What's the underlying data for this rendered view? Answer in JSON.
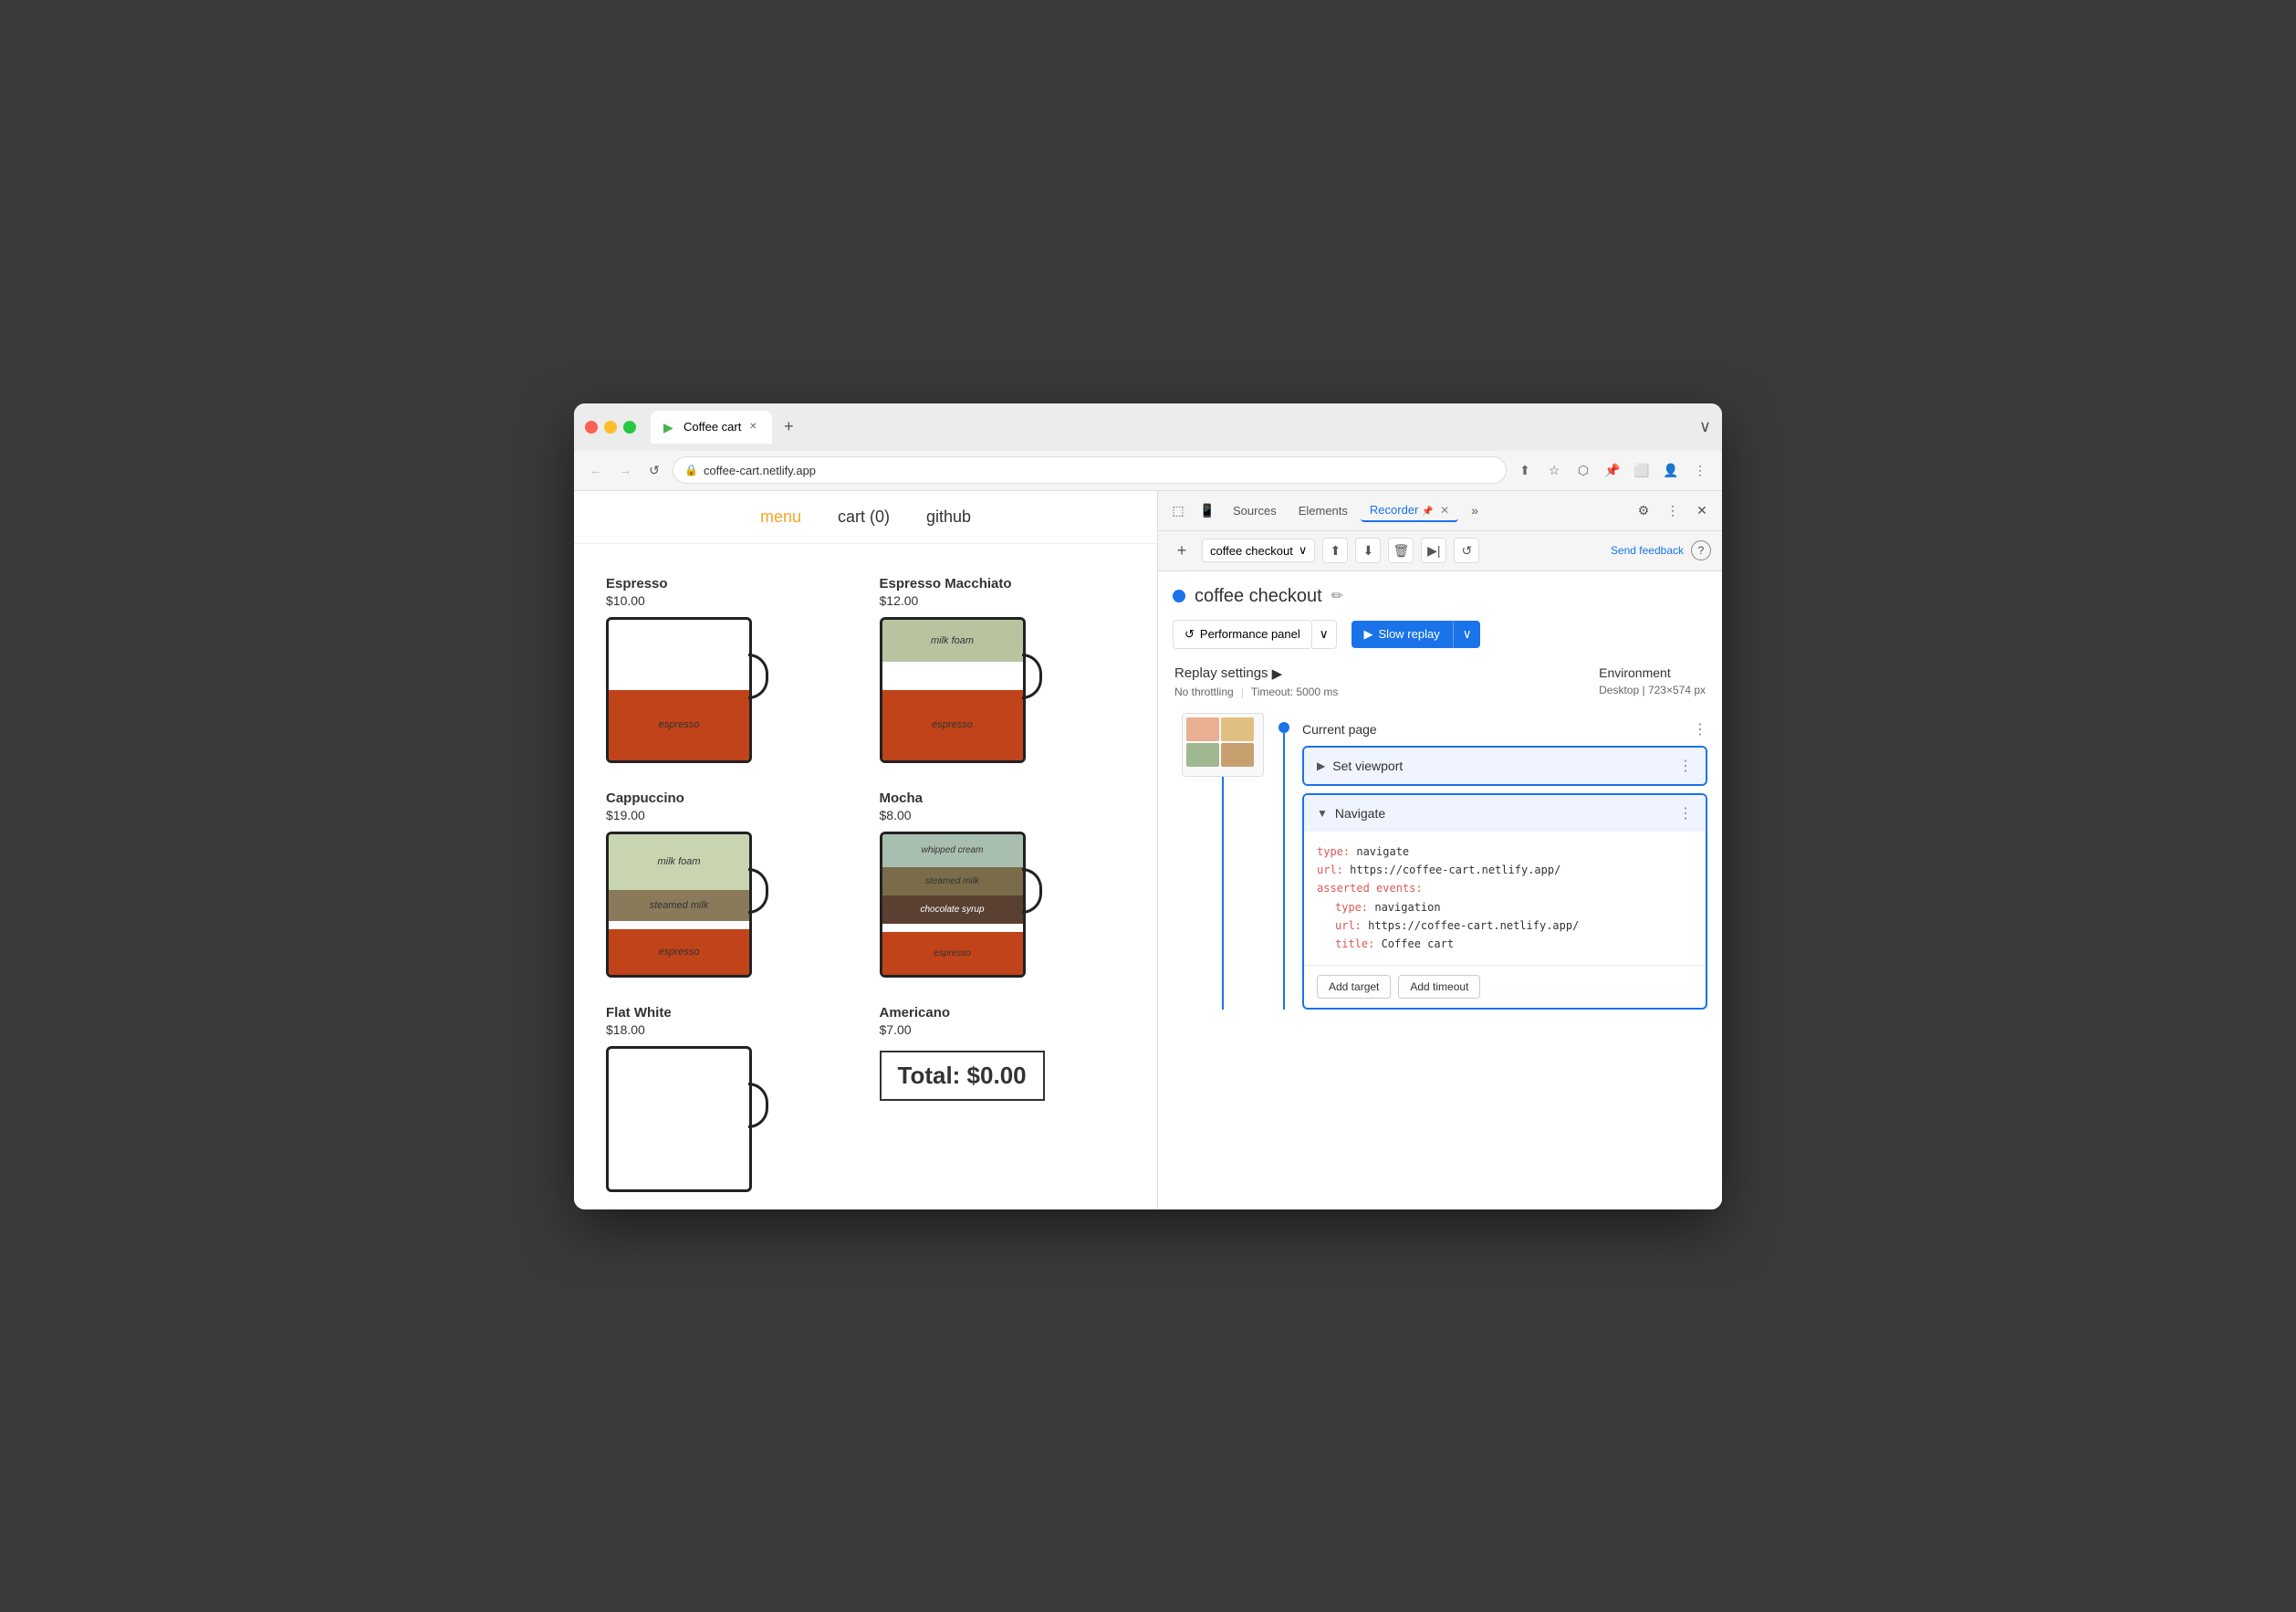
{
  "browser": {
    "tab_title": "Coffee cart",
    "tab_favicon": "▶",
    "address": "coffee-cart.netlify.app",
    "new_tab_label": "+",
    "chevron_right": "›"
  },
  "nav": {
    "back_icon": "←",
    "forward_icon": "→",
    "refresh_icon": "↺",
    "lock_icon": "🔒",
    "address_url": "coffee-cart.netlify.app",
    "share_icon": "⬆",
    "star_icon": "☆",
    "extension_icon": "⬡",
    "pin_icon": "📌",
    "split_icon": "⬜",
    "profile_icon": "👤",
    "more_icon": "⋮"
  },
  "site": {
    "nav": {
      "menu_label": "menu",
      "cart_label": "cart (0)",
      "github_label": "github"
    },
    "coffees": [
      {
        "name": "Espresso",
        "price": "$10.00",
        "layers": [
          {
            "label": "espresso",
            "class": "espresso-layer-espresso",
            "height": "50%",
            "bottom": "0"
          }
        ]
      },
      {
        "name": "Espresso Macchiato",
        "price": "$12.00",
        "layers": [
          {
            "label": "milk foam",
            "class": "macchiato-layer-foam",
            "height": "30%",
            "top": "0"
          },
          {
            "label": "espresso",
            "class": "macchiato-layer-espresso",
            "height": "50%",
            "bottom": "0"
          }
        ]
      },
      {
        "name": "Cappuccino",
        "price": "$19.00",
        "layers": [
          {
            "label": "milk foam",
            "class": "capp-layer-foam"
          },
          {
            "label": "steamed milk",
            "class": "capp-layer-steamed"
          },
          {
            "label": "espresso",
            "class": "capp-layer-espresso"
          }
        ]
      },
      {
        "name": "Mocha",
        "price": "$8.00",
        "layers": [
          {
            "label": "whipped cream",
            "class": "mocha-layer-whipped"
          },
          {
            "label": "steamed milk",
            "class": "mocha-layer-steamed"
          },
          {
            "label": "chocolate syrup",
            "class": "mocha-layer-chocolate"
          },
          {
            "label": "espresso",
            "class": "mocha-layer-espresso"
          }
        ]
      },
      {
        "name": "Flat White",
        "price": "$18.00",
        "layers": []
      },
      {
        "name": "Americano",
        "price": "$7.00",
        "total": "Total: $0.00",
        "layers": []
      }
    ],
    "total": "Total: $0.00"
  },
  "devtools": {
    "tabs": [
      "Sources",
      "Elements",
      "Recorder"
    ],
    "active_tab": "Recorder",
    "close_icon": "✕",
    "more_tabs_icon": "»",
    "settings_icon": "⚙",
    "more_icon": "⋮",
    "close_panel_icon": "✕",
    "recording": {
      "name": "coffee checkout",
      "dot_color": "#1a73e8",
      "edit_icon": "✏",
      "buttons": {
        "performance_panel": "Performance panel",
        "slow_replay": "Slow replay",
        "replay_icon": "▶"
      },
      "replay_settings": {
        "title": "Replay settings",
        "arrow": "▶",
        "throttling": "No throttling",
        "timeout": "Timeout: 5000 ms",
        "environment_title": "Environment",
        "environment_value": "Desktop",
        "resolution": "723×574 px"
      },
      "current_page": {
        "label": "Current page",
        "more_icon": "⋮"
      },
      "steps": [
        {
          "id": "set-viewport",
          "title": "Set viewport",
          "collapsed": true,
          "toggle": "▶"
        },
        {
          "id": "navigate",
          "title": "Navigate",
          "expanded": true,
          "toggle": "▼",
          "code": {
            "type_key": "type:",
            "type_val": " navigate",
            "url_key": "url:",
            "url_val": " https://coffee-cart.netlify.app/",
            "asserted_key": "asserted events:",
            "asserted_type_key": "    type:",
            "asserted_type_val": " navigation",
            "asserted_url_key": "    url:",
            "asserted_url_val": " https://coffee-cart.netlify.app/",
            "asserted_title_key": "    title:",
            "asserted_title_val": " Coffee cart"
          },
          "buttons": {
            "add_target": "Add target",
            "add_timeout": "Add timeout"
          }
        }
      ]
    }
  }
}
